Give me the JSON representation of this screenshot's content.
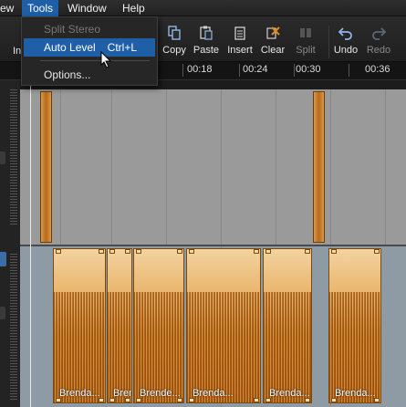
{
  "menubar": {
    "items": [
      {
        "label": "ew"
      },
      {
        "label": "Tools"
      },
      {
        "label": "Window"
      },
      {
        "label": "Help"
      }
    ]
  },
  "toolbar": {
    "edge_label": "In",
    "buttons": [
      {
        "label": "Copy",
        "icon": "copy-icon"
      },
      {
        "label": "Paste",
        "icon": "paste-icon"
      },
      {
        "label": "Insert",
        "icon": "insert-icon"
      },
      {
        "label": "Clear",
        "icon": "clear-icon"
      },
      {
        "label": "Split",
        "icon": "split-icon"
      },
      {
        "label": "Undo",
        "icon": "undo-icon"
      },
      {
        "label": "Redo",
        "icon": "redo-icon"
      }
    ]
  },
  "tools_menu": {
    "items": [
      {
        "label": "Split Stereo",
        "shortcut": ""
      },
      {
        "label": "Auto Level",
        "shortcut": "Ctrl+L"
      },
      {
        "label": "Options...",
        "shortcut": ""
      }
    ]
  },
  "ruler": {
    "ticks": [
      "00:18",
      "00:24",
      "00:30",
      "00:36"
    ]
  },
  "tracks": {
    "track2_clips": [
      "Brenda...",
      "Brende...",
      "Brende...",
      "Brenda...",
      "Brenda...",
      "Brenda..."
    ]
  },
  "colors": {
    "accent": "#1e5fa8",
    "clip_fill": "#e9b46a",
    "track_bg": "#9a9a9a"
  }
}
